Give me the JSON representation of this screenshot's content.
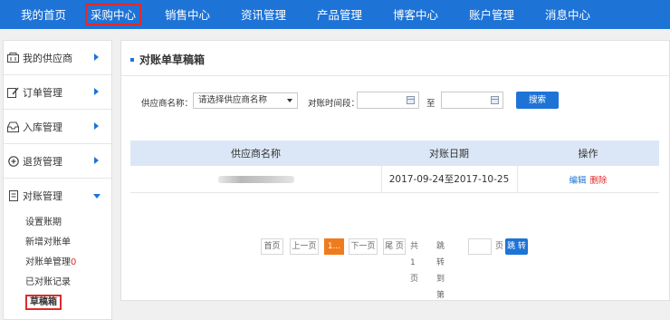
{
  "topnav": {
    "items": [
      "我的首页",
      "采购中心",
      "销售中心",
      "资讯管理",
      "产品管理",
      "博客中心",
      "账户管理",
      "消息中心"
    ],
    "active_index": 1
  },
  "sidebar": {
    "groups": [
      {
        "label": "我的供应商",
        "icon": "building-icon"
      },
      {
        "label": "订单管理",
        "icon": "edit-icon"
      },
      {
        "label": "入库管理",
        "icon": "inbox-icon"
      },
      {
        "label": "退货管理",
        "icon": "return-icon"
      },
      {
        "label": "对账管理",
        "icon": "document-icon"
      }
    ],
    "sub_items": [
      {
        "label": "设置账期"
      },
      {
        "label": "新增对账单"
      },
      {
        "label": "对账单管理",
        "badge": "0"
      },
      {
        "label": "已对账记录"
      },
      {
        "label": "草稿箱",
        "current": true
      }
    ]
  },
  "main": {
    "title": "对账单草稿箱",
    "filter": {
      "supplier_label": "供应商名称：",
      "supplier_placeholder": "请选择供应商名称",
      "period_label": "对账时间段：",
      "to_label": "至",
      "search_button": "搜索"
    },
    "table": {
      "headers": [
        "供应商名称",
        "对账日期",
        "操作"
      ],
      "rows": [
        {
          "date_range": "2017-09-24至2017-10-25",
          "edit": "编辑",
          "delete": "删除"
        }
      ]
    },
    "pager": {
      "first": "首页",
      "prev": "上一页",
      "current": "1...",
      "next": "下一页",
      "last": "尾 页",
      "total": "共1页",
      "jump_label": "跳转到第",
      "page_suffix": "页",
      "go": "跳 转"
    }
  },
  "colors": {
    "nav_blue": "#1e73d6",
    "highlight_red": "#e02a2a",
    "pager_orange": "#f07b1c",
    "table_header": "#dbe7f6"
  }
}
